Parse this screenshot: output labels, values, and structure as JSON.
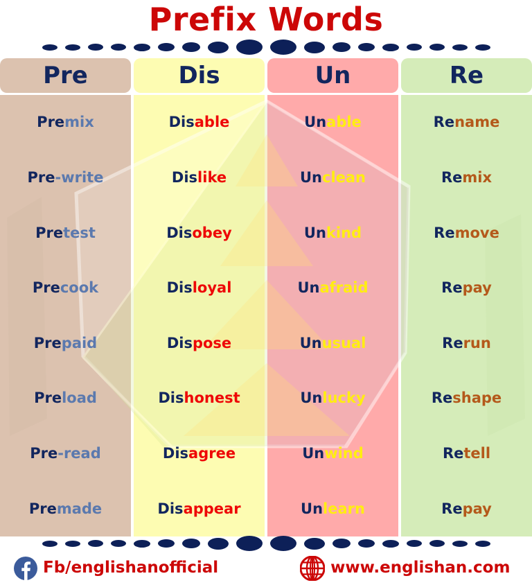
{
  "title": "Prefix Words",
  "title_color": "#cc0707",
  "divider": {
    "name": "dotted-divider",
    "dot_color": "#0d2058",
    "dot_widths": [
      22,
      22,
      22,
      22,
      24,
      24,
      26,
      30,
      38,
      38,
      30,
      26,
      24,
      24,
      22,
      22,
      22,
      22
    ],
    "dot_heights": [
      9,
      9,
      10,
      10,
      11,
      12,
      14,
      17,
      22,
      22,
      17,
      14,
      12,
      11,
      10,
      10,
      9,
      9
    ]
  },
  "columns": [
    {
      "header": "Pre",
      "bg": "#dcc2af",
      "prefix_color": "#12265e",
      "suffix_color": "#5b79ae",
      "words": [
        {
          "prefix": "Pre",
          "suffix": "mix"
        },
        {
          "prefix": "Pre",
          "suffix": "-write"
        },
        {
          "prefix": "Pre",
          "suffix": "test"
        },
        {
          "prefix": "Pre",
          "suffix": "cook"
        },
        {
          "prefix": "Pre",
          "suffix": "paid"
        },
        {
          "prefix": "Pre",
          "suffix": "load"
        },
        {
          "prefix": "Pre",
          "suffix": "-read"
        },
        {
          "prefix": "Pre",
          "suffix": "made"
        }
      ]
    },
    {
      "header": "Dis",
      "bg": "#fdfcb2",
      "prefix_color": "#12265e",
      "suffix_color": "#ee0707",
      "words": [
        {
          "prefix": "Dis",
          "suffix": "able"
        },
        {
          "prefix": "Dis",
          "suffix": "like"
        },
        {
          "prefix": "Dis",
          "suffix": "obey"
        },
        {
          "prefix": "Dis",
          "suffix": "loyal"
        },
        {
          "prefix": "Dis",
          "suffix": "pose"
        },
        {
          "prefix": "Dis",
          "suffix": "honest"
        },
        {
          "prefix": "Dis",
          "suffix": "agree"
        },
        {
          "prefix": "Dis",
          "suffix": "appear"
        }
      ]
    },
    {
      "header": "Un",
      "bg": "#ffaaaa",
      "prefix_color": "#12265e",
      "suffix_color": "#ffee11",
      "words": [
        {
          "prefix": "Un",
          "suffix": "able"
        },
        {
          "prefix": "Un",
          "suffix": "clean"
        },
        {
          "prefix": "Un",
          "suffix": "kind"
        },
        {
          "prefix": "Un",
          "suffix": "afraid"
        },
        {
          "prefix": "Un",
          "suffix": "usual"
        },
        {
          "prefix": "Un",
          "suffix": "lucky"
        },
        {
          "prefix": "Un",
          "suffix": "wind"
        },
        {
          "prefix": "Un",
          "suffix": "learn"
        }
      ]
    },
    {
      "header": "Re",
      "bg": "#d5ecb9",
      "prefix_color": "#12265e",
      "suffix_color": "#b4591b",
      "words": [
        {
          "prefix": "Re",
          "suffix": "name"
        },
        {
          "prefix": "Re",
          "suffix": "mix"
        },
        {
          "prefix": "Re",
          "suffix": "move"
        },
        {
          "prefix": "Re",
          "suffix": "pay"
        },
        {
          "prefix": "Re",
          "suffix": "run"
        },
        {
          "prefix": "Re",
          "suffix": "shape"
        },
        {
          "prefix": "Re",
          "suffix": "tell"
        },
        {
          "prefix": "Re",
          "suffix": "pay"
        }
      ]
    }
  ],
  "footer": {
    "facebook": {
      "icon": "facebook-icon",
      "icon_bg": "#3b5b9b",
      "text": "Fb/englishanofficial"
    },
    "website": {
      "icon": "globe-icon",
      "icon_color": "#cc0707",
      "text": "www.englishan.com"
    },
    "text_color": "#cc0707"
  }
}
